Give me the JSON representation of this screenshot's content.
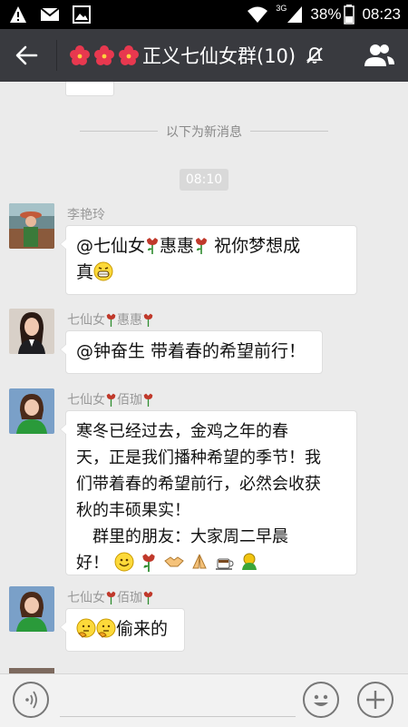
{
  "status_bar": {
    "network": "3G",
    "battery": "38%",
    "time": "08:23"
  },
  "header": {
    "title": "正义七仙女群(10)",
    "muted": true
  },
  "divider": {
    "new_messages": "以下为新消息"
  },
  "time_badge": "08:10",
  "messages": [
    {
      "sender": "李艳玲",
      "lines": [
        "@七仙女",
        "惠惠",
        "祝你梦想成",
        "真"
      ]
    },
    {
      "sender_a": "七仙女",
      "sender_b": "惠惠",
      "text": "@钟奋生 带着春的希望前行！"
    },
    {
      "sender_a": "七仙女",
      "sender_b": "佰珈",
      "lines": [
        "寒冬已经过去，金鸡之年的春",
        "天，正是我们播种希望的季节！我",
        "们带着春的希望前行，必然会收获",
        "秋的丰硕果实！",
        "　群里的朋友：大家周二早晨",
        "好！"
      ]
    },
    {
      "sender_a": "七仙女",
      "sender_b": "佰珈",
      "text": "偷来的"
    }
  ],
  "colors": {
    "header_bg": "#393a3f",
    "chat_bg": "#ebebeb",
    "rose": "#c0392b"
  },
  "icons": [
    "warning-icon",
    "mail-icon",
    "image-icon",
    "wifi-icon",
    "signal-icon",
    "battery-icon",
    "back-arrow-icon",
    "mute-icon",
    "members-icon",
    "voice-icon",
    "emoji-face-icon",
    "plus-icon"
  ]
}
